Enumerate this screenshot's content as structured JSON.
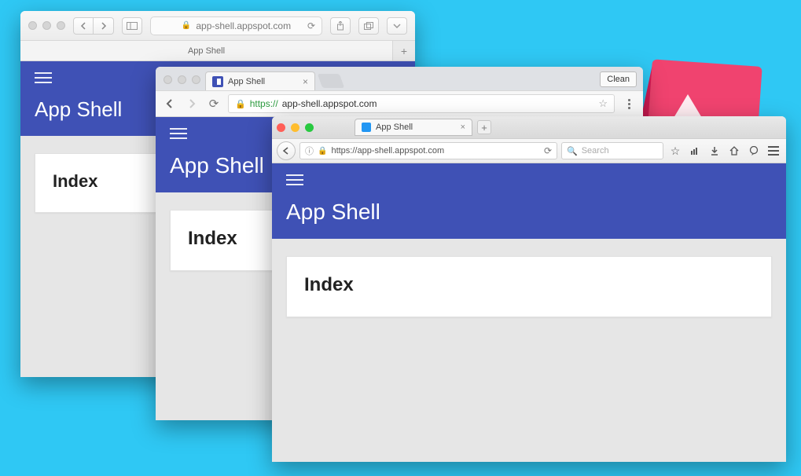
{
  "app": {
    "title": "App Shell",
    "card_heading": "Index"
  },
  "safari": {
    "url_display": "app-shell.appspot.com",
    "tab_title": "App Shell"
  },
  "chrome": {
    "tab_title": "App Shell",
    "clean_button": "Clean",
    "url_scheme": "https://",
    "url_rest": "app-shell.appspot.com"
  },
  "firefox": {
    "tab_title": "App Shell",
    "url_display": "https://app-shell.appspot.com",
    "search_placeholder": "Search"
  }
}
